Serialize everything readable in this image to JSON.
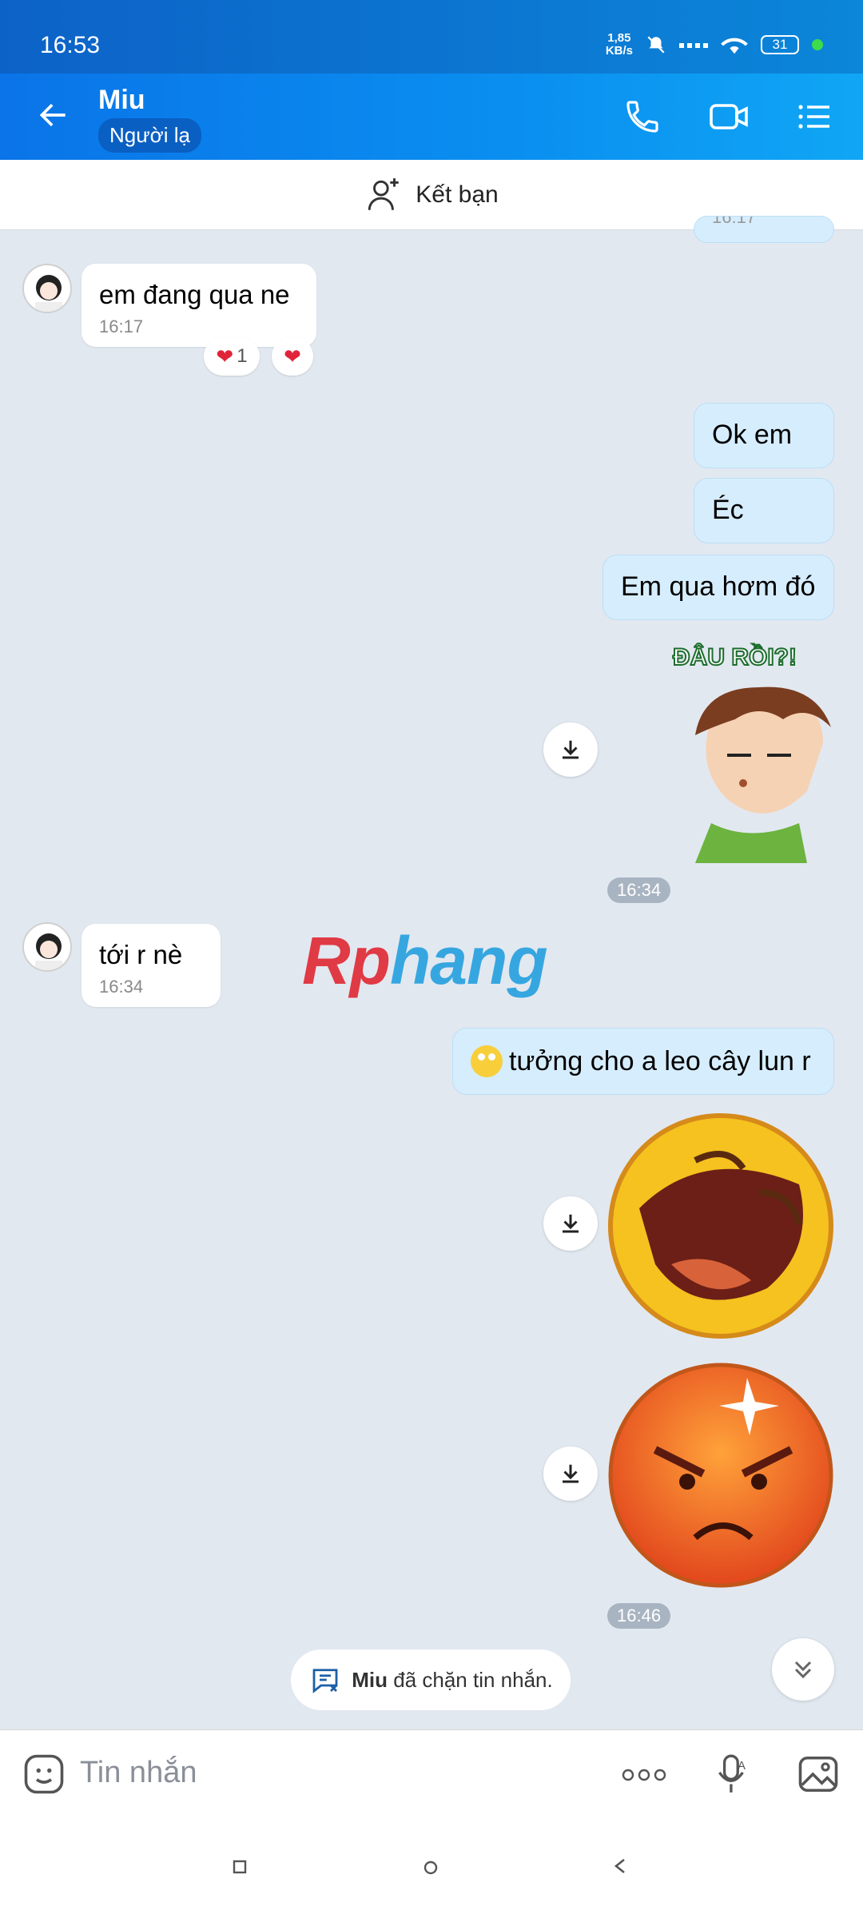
{
  "status_bar": {
    "time": "16:53",
    "netspeed": "1,85",
    "netspeed_unit": "KB/s",
    "battery": "31"
  },
  "header": {
    "name": "Miu",
    "badge": "Người lạ"
  },
  "add_friend": {
    "label": "Kết bạn"
  },
  "messages": {
    "m1": {
      "text": "em đang qua ne",
      "time": "16:17",
      "reaction_count": "1"
    },
    "m2": {
      "text": "Ok em"
    },
    "m3": {
      "text": "Éc"
    },
    "m4": {
      "text": "Em qua hơm đó"
    },
    "sticker1_text": "ĐÂU RỒI?!",
    "time_1634": "16:34",
    "m5": {
      "text": "tới r nè",
      "time": "16:34"
    },
    "m6": {
      "text": "tưởng cho a leo cây lun r"
    },
    "time_1646": "16:46",
    "top_partial_time": "16:17"
  },
  "watermark": {
    "part1": "Rp",
    "part2": "hang"
  },
  "blocked_notice": {
    "name": "Miu",
    "text": " đã chặn tin nhắn."
  },
  "input": {
    "placeholder": "Tin nhắn"
  },
  "colors": {
    "header_start": "#0a74e8",
    "header_end": "#10a6f5",
    "bubble_out": "#d6edfd",
    "background": "#e2e8f0"
  }
}
